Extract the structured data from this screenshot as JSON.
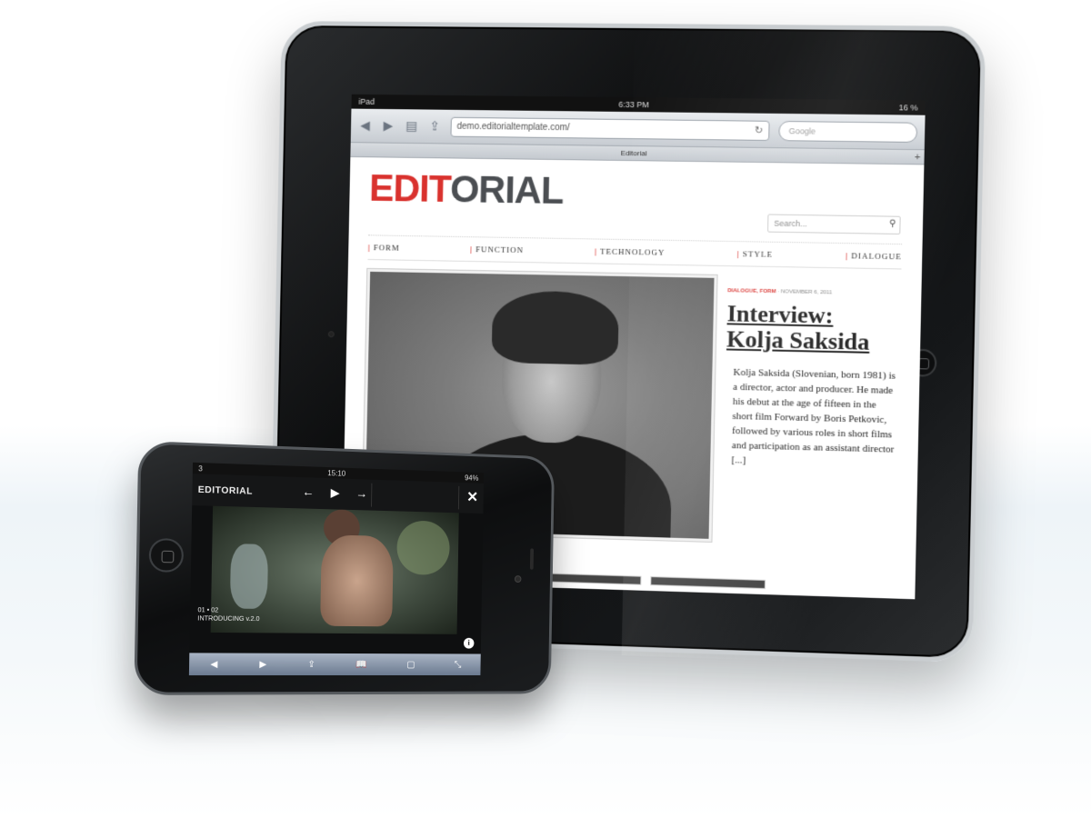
{
  "ipad": {
    "status": {
      "carrier": "iPad",
      "time": "6:33 PM",
      "battery": "16 %"
    },
    "safari": {
      "url": "demo.editorialtemplate.com/",
      "search_placeholder": "Google",
      "tab_title": "Editorial",
      "icons": [
        "back-icon",
        "forward-icon",
        "bookmarks-icon",
        "share-icon",
        "reload-icon",
        "plus-icon",
        "close-icon"
      ]
    },
    "site": {
      "brand_red": "EDIT",
      "brand_grey": "ORIAL",
      "search_placeholder": "Search...",
      "menu": [
        "FORM",
        "FUNCTION",
        "TECHNOLOGY",
        "STYLE",
        "DIALOGUE"
      ],
      "article": {
        "categories": "DIALOGUE, FORM",
        "date": "· NOVEMBER 6, 2011",
        "headline_line1": "Interview:",
        "headline_line2": "Kolja Saksida",
        "excerpt": "Kolja Saksida (Slovenian, born 1981) is a director, actor and producer. He made his debut at the age of fifteen in the short film Forward by Boris Petkovic, followed by various roles in short films and participation as an assistant director [...]"
      }
    }
  },
  "iphone": {
    "status": {
      "carrier": "3",
      "time": "15:10",
      "battery": "94%"
    },
    "brand": "EDITORIAL",
    "controls": {
      "prev": "←",
      "play": "▶",
      "next": "→",
      "close": "✕"
    },
    "video": {
      "counter": "01 • 02",
      "title": "INTRODUCING v.2.0"
    },
    "info": "i",
    "toolbar": [
      "◀",
      "▶",
      "⇪",
      "📖",
      "▢",
      "⤡"
    ]
  },
  "colors": {
    "brand_red": "#d9322e",
    "brand_grey": "#4b4e52",
    "toolbar_blue": "#6b7a90"
  }
}
